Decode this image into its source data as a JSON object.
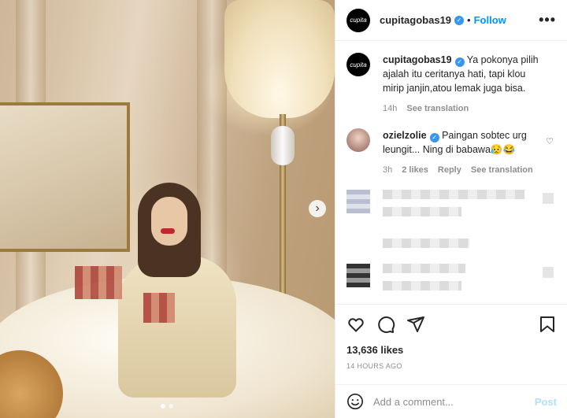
{
  "post": {
    "author": "cupitagobas19",
    "avatar_text": "cupita",
    "follow_label": "Follow",
    "separator": "•",
    "more_label": "•••",
    "next_label": "›",
    "carousel": {
      "slides": 2,
      "active": 1
    }
  },
  "caption": {
    "user": "cupitagobas19",
    "text": "Ya pokonya pilih ajalah itu ceritanya hati, tapi klou mirip janjin,atou lemak juga bisa.",
    "time": "14h",
    "see_translation": "See translation"
  },
  "comments": [
    {
      "user": "ozielzolie",
      "text": "Paingan sobtec urg leungit... Ning di babawa😥😂",
      "time": "3h",
      "likes": "2 likes",
      "reply": "Reply",
      "see_translation": "See translation"
    }
  ],
  "engagement": {
    "likes": "13,636 likes",
    "posted": "14 HOURS AGO"
  },
  "composer": {
    "placeholder": "Add a comment...",
    "post_label": "Post"
  },
  "colors": {
    "accent": "#0095f6",
    "verified": "#3897f0",
    "post_disabled": "#b2dffc",
    "muted": "#8e8e8e"
  },
  "icons": {
    "like": "heart-icon",
    "comment": "comment-icon",
    "share": "send-icon",
    "save": "bookmark-icon",
    "emoji": "emoji-icon",
    "verified": "verified-badge-icon",
    "more": "more-options-icon",
    "next": "chevron-right-icon"
  }
}
